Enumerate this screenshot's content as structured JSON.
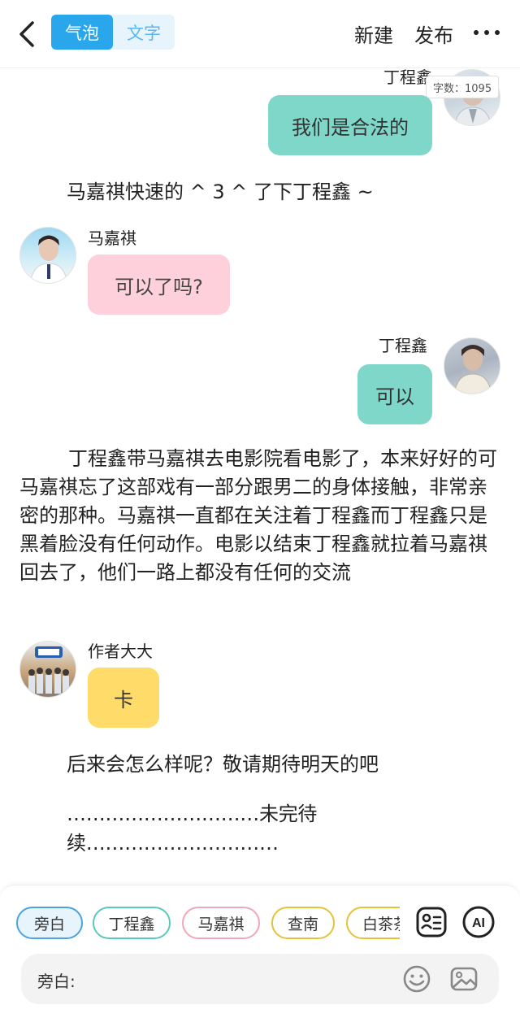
{
  "header": {
    "tabs": [
      {
        "label": "气泡",
        "active": true
      },
      {
        "label": "文字",
        "active": false
      }
    ],
    "new_label": "新建",
    "publish_label": "发布"
  },
  "word_count": "字数：1095",
  "messages": [
    {
      "type": "bubble",
      "side": "right",
      "name": "丁程鑫",
      "text": "我们是合法的",
      "color": "#7fd7c9"
    },
    {
      "type": "narration",
      "text": "马嘉祺快速的 ^ 3 ^ 了下丁程鑫 ~"
    },
    {
      "type": "bubble",
      "side": "left",
      "name": "马嘉祺",
      "text": "可以了吗?",
      "color": "#fdd0db"
    },
    {
      "type": "bubble",
      "side": "right",
      "name": "丁程鑫",
      "text": "可以",
      "color": "#7fd7c9"
    },
    {
      "type": "paragraph",
      "text": "丁程鑫带马嘉祺去电影院看电影了，本来好好的可马嘉祺忘了这部戏有一部分跟男二的身体接触，非常亲密的那种。马嘉祺一直都在关注着丁程鑫而丁程鑫只是黑着脸没有任何动作。电影以结束丁程鑫就拉着马嘉祺回去了，他们一路上都没有任何的交流"
    },
    {
      "type": "bubble",
      "side": "left",
      "name": "作者大大",
      "text": "卡",
      "color": "#ffdc6a"
    },
    {
      "type": "narration",
      "text": "后来会怎么样呢？敬请期待明天的吧"
    },
    {
      "type": "narration",
      "text": "…………………………未完待续…………………………"
    }
  ],
  "characters": [
    {
      "label": "旁白",
      "color": "#4aa3df",
      "active": true
    },
    {
      "label": "丁程鑫",
      "color": "#5cc8bb",
      "active": false
    },
    {
      "label": "马嘉祺",
      "color": "#f2a6b9",
      "active": false
    },
    {
      "label": "查南",
      "color": "#e6c23a",
      "active": false
    },
    {
      "label": "白茶茶",
      "color": "#e6c23a",
      "active": false
    }
  ],
  "input": {
    "label": "旁白:",
    "value": ""
  },
  "icons": {
    "back": "chevron-left-icon",
    "more": "more-dots-icon",
    "character_card": "character-card-icon",
    "ai": "ai-icon",
    "emoji": "emoji-icon",
    "image": "image-icon"
  }
}
